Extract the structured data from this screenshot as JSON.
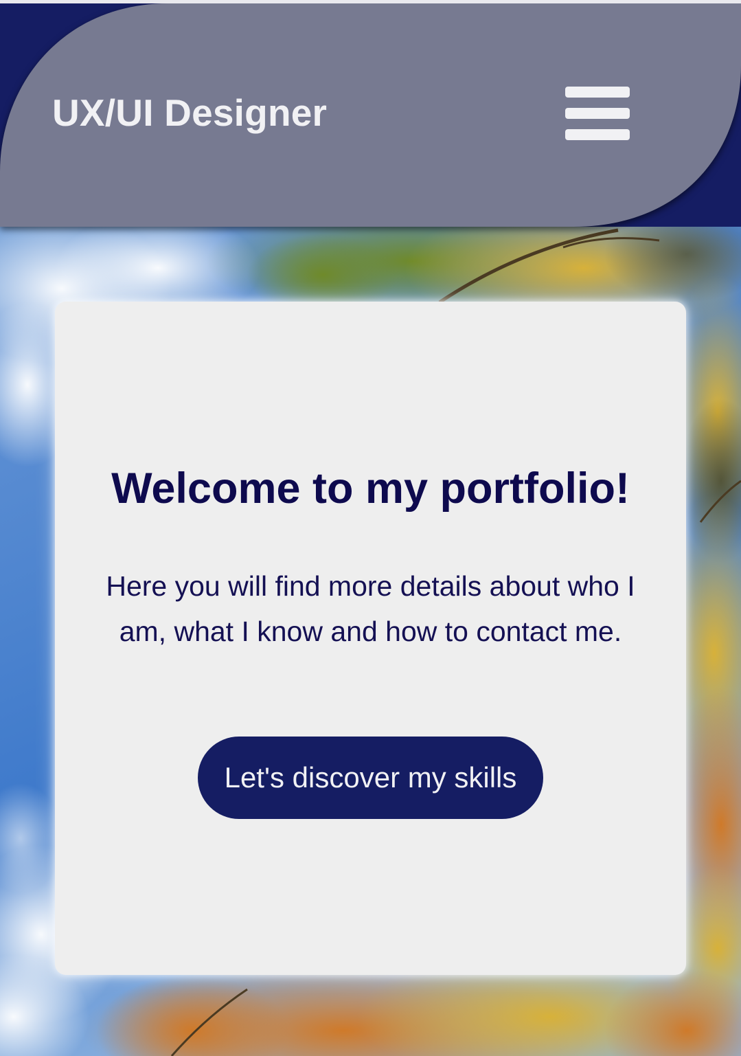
{
  "header": {
    "title": "UX/UI Designer",
    "menu_icon": "hamburger-menu-icon"
  },
  "hero": {
    "background_image": "sky-and-autumn-foliage-photo",
    "heading": "Welcome to my portfolio!",
    "description": "Here you will find more details about who I am, what I know and how to contact me.",
    "cta_label": "Let's discover my skills"
  },
  "colors": {
    "navy": "#151d63",
    "header_gray": "#777a91",
    "card_background": "#eeeeee",
    "heading_text": "#0e0a4e",
    "light_text": "#f1f1f4"
  }
}
